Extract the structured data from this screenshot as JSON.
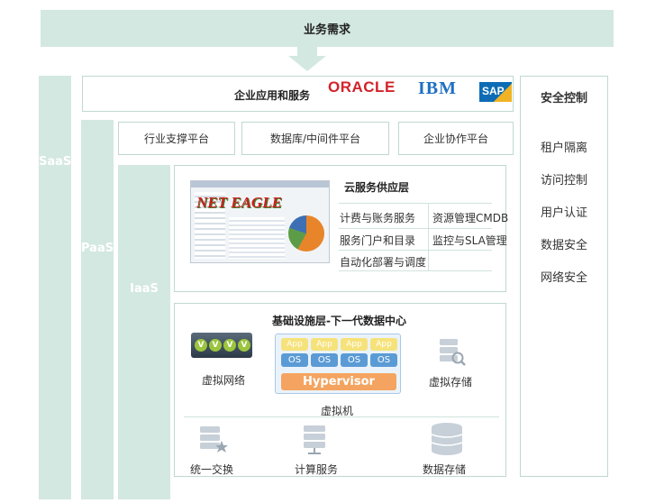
{
  "top_banner": {
    "label": "业务需求"
  },
  "layers": {
    "saas": "SaaS",
    "paas": "PaaS",
    "iaas": "IaaS"
  },
  "enterprise": {
    "title": "企业应用和服务",
    "logos": {
      "oracle": "ORACLE",
      "ibm": "IBM",
      "sap": "SAP"
    }
  },
  "platforms": [
    "行业支撑平台",
    "数据库/中间件平台",
    "企业协作平台"
  ],
  "cloud_service": {
    "title": "云服务供应层",
    "screenshot_logo": "NET EAGLE",
    "items": {
      "billing": "计费与账务服务",
      "resource": "资源管理CMDB",
      "portal": "服务门户和目录",
      "monitor": "监控与SLA管理",
      "automation": "自动化部署与调度"
    }
  },
  "infrastructure": {
    "title": "基础设施层-下一代数据中心",
    "virtual_network": "虚拟网络",
    "virtual_machine": "虚拟机",
    "virtual_storage": "虚拟存储",
    "app_label": "App",
    "os_label": "OS",
    "hypervisor": "Hypervisor",
    "v_label": "V",
    "bottom": [
      "统一交换",
      "计算服务",
      "数据存储"
    ]
  },
  "security": {
    "title": "安全控制",
    "items": [
      "租户隔离",
      "访问控制",
      "用户认证",
      "数据安全",
      "网络安全"
    ]
  },
  "colors": {
    "band": "#d3e8e0",
    "border": "#bfd9cf",
    "oracle_red": "#d2232a",
    "ibm_blue": "#1f70c1",
    "sap_blue": "#0d6cb5",
    "sap_gold": "#f0b323",
    "vm_yellow": "#f6e27a",
    "vm_blue": "#5b9bd5",
    "hypervisor_orange": "#f4a460"
  }
}
